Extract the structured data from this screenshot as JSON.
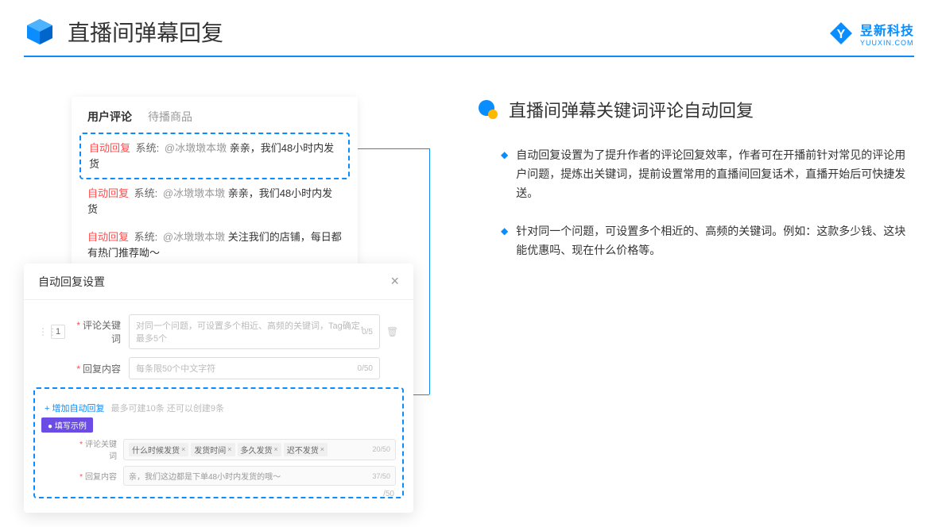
{
  "header": {
    "title": "直播间弹幕回复",
    "logo_title": "昱新科技",
    "logo_sub": "YUUXIN.COM"
  },
  "comment_panel": {
    "tabs": {
      "active": "用户评论",
      "inactive": "待播商品"
    },
    "items": [
      {
        "tag": "自动回复",
        "sys": "系统:",
        "user": "@冰墩墩本墩",
        "text": " 亲亲，我们48小时内发货"
      },
      {
        "tag": "自动回复",
        "sys": "系统:",
        "user": "@冰墩墩本墩",
        "text": " 亲亲，我们48小时内发货"
      },
      {
        "tag": "自动回复",
        "sys": "系统:",
        "user": "@冰墩墩本墩",
        "text": " 关注我们的店铺，每日都有热门推荐呦～"
      }
    ]
  },
  "dialog": {
    "title": "自动回复设置",
    "row_number": "1",
    "keyword_label": "评论关键词",
    "keyword_placeholder": "对同一个问题，可设置多个相近、高频的关键词，Tag确定，最多5个",
    "keyword_count": "0/5",
    "content_label": "回复内容",
    "content_placeholder": "每条限50个中文字符",
    "content_count": "0/50",
    "add_link": "+ 增加自动回复",
    "add_hint": "最多可建10条 还可以创建9条",
    "example_badge": "● 填写示例",
    "example_kw_label": "评论关键词",
    "example_tags": [
      "什么时候发货",
      "发货时间",
      "多久发货",
      "迟不发货"
    ],
    "example_kw_count": "20/50",
    "example_content_label": "回复内容",
    "example_content": "亲，我们这边都是下单48小时内发货的哦～",
    "example_content_count": "37/50",
    "outer_count": "/50"
  },
  "right": {
    "title": "直播间弹幕关键词评论自动回复",
    "bullets": [
      "自动回复设置为了提升作者的评论回复效率，作者可在开播前针对常见的评论用户问题，提炼出关键词，提前设置常用的直播间回复话术，直播开始后可快捷发送。",
      "针对同一个问题，可设置多个相近的、高频的关键词。例如：这款多少钱、这块能优惠吗、现在什么价格等。"
    ]
  }
}
